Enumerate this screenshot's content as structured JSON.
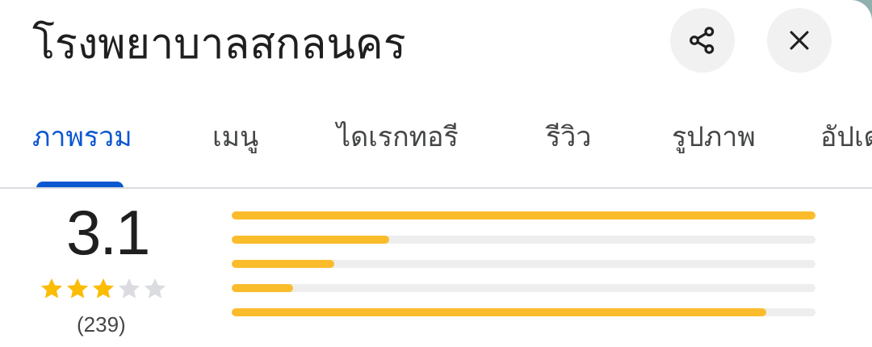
{
  "header": {
    "title": "โรงพยาบาลสกลนคร",
    "share_icon": "share-icon",
    "close_icon": "close-icon"
  },
  "tabs": [
    {
      "label": "ภาพรวม",
      "active": true
    },
    {
      "label": "เมนู",
      "active": false
    },
    {
      "label": "ไดเรกทอรี",
      "active": false
    },
    {
      "label": "รีวิว",
      "active": false
    },
    {
      "label": "รูปภาพ",
      "active": false
    },
    {
      "label": "อัปเด",
      "active": false
    }
  ],
  "rating": {
    "value": "3.1",
    "stars_filled": 3,
    "stars_total": 5,
    "review_count": "(239)",
    "distribution_fraction": [
      1.0,
      0.27,
      0.175,
      0.105,
      0.915
    ]
  },
  "colors": {
    "accent": "#0b57d0",
    "star": "#fbbc04",
    "star_empty": "#dadce0",
    "bar_fill": "#fbbc2c",
    "bar_track": "#eeeeee"
  }
}
